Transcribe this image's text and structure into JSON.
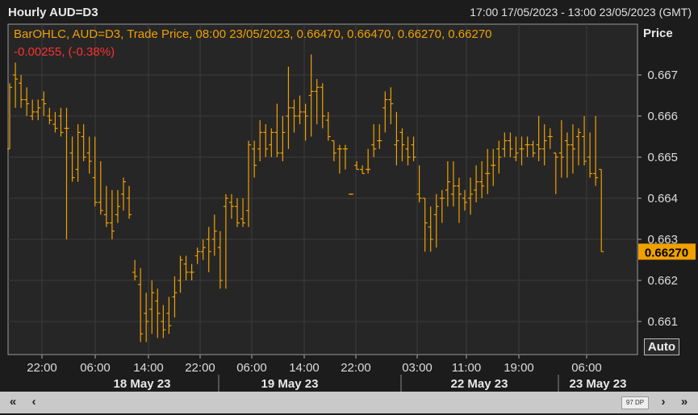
{
  "window": {
    "title": "Hourly AUD=D3",
    "date_range": "17:00 17/05/2023 - 13:00 23/05/2023 (GMT)"
  },
  "legend": {
    "line1": "BarOHLC, AUD=D3, Trade Price, 08:00 23/05/2023, 0.66470, 0.66470, 0.66270, 0.66270",
    "line2": "-0.00255, (-0.38%)",
    "color_series": "#f0a000",
    "color_change": "#ff3030"
  },
  "price_axis": {
    "label": "Price",
    "last_value": "0.66270",
    "auto_label": "Auto"
  },
  "nav": {
    "back_all": "«",
    "back": "‹",
    "points": "97 DP",
    "forward": "›",
    "forward_all": "»"
  },
  "chart_data": {
    "type": "ohlc",
    "title": "Hourly AUD=D3",
    "ylabel": "Price",
    "ylim": [
      0.6604,
      0.6675
    ],
    "yticks": [
      "0.667",
      "0.666",
      "0.665",
      "0.664",
      "0.663",
      "0.662",
      "0.661"
    ],
    "x_time_labels": [
      "22:00",
      "06:00",
      "14:00",
      "22:00",
      "06:00",
      "14:00",
      "22:00",
      "03:00",
      "11:00",
      "19:00",
      "06:00"
    ],
    "x_date_labels": [
      "18 May 23",
      "19 May 23",
      "22 May 23",
      "23 May 23"
    ],
    "grid": true,
    "series": [
      {
        "name": "AUD=D3",
        "color": "#f0a000",
        "bars": [
          [
            0.6652,
            0.6668,
            0.6652,
            0.6667
          ],
          [
            0.667,
            0.6673,
            0.6662,
            0.6669
          ],
          [
            0.6668,
            0.667,
            0.6662,
            0.6664
          ],
          [
            0.6664,
            0.6667,
            0.666,
            0.6663
          ],
          [
            0.666,
            0.6664,
            0.6659,
            0.6661
          ],
          [
            0.6661,
            0.6664,
            0.6659,
            0.6662
          ],
          [
            0.6664,
            0.6666,
            0.666,
            0.6663
          ],
          [
            0.666,
            0.6662,
            0.6658,
            0.6659
          ],
          [
            0.6658,
            0.6661,
            0.6656,
            0.6657
          ],
          [
            0.666,
            0.6662,
            0.6655,
            0.6656
          ],
          [
            0.6657,
            0.6662,
            0.663,
            0.6657
          ],
          [
            0.6651,
            0.6655,
            0.6644,
            0.6645
          ],
          [
            0.6647,
            0.6658,
            0.6644,
            0.6656
          ],
          [
            0.6655,
            0.6658,
            0.6649,
            0.665
          ],
          [
            0.6651,
            0.6655,
            0.6646,
            0.6649
          ],
          [
            0.6645,
            0.6655,
            0.6638,
            0.6639
          ],
          [
            0.6639,
            0.6649,
            0.6636,
            0.6637
          ],
          [
            0.6636,
            0.6643,
            0.6633,
            0.6634
          ],
          [
            0.6634,
            0.6642,
            0.663,
            0.6632
          ],
          [
            0.6636,
            0.6642,
            0.6634,
            0.6638
          ],
          [
            0.6641,
            0.6645,
            0.6637,
            0.6644
          ],
          [
            0.664,
            0.6643,
            0.6635,
            0.6636
          ],
          [
            0.6622,
            0.6625,
            0.662,
            0.6621
          ],
          [
            0.6619,
            0.6623,
            0.6605,
            0.6607
          ],
          [
            0.6612,
            0.6617,
            0.6605,
            0.661
          ],
          [
            0.6613,
            0.662,
            0.6607,
            0.6617
          ],
          [
            0.6615,
            0.6618,
            0.6606,
            0.6612
          ],
          [
            0.661,
            0.6614,
            0.6606,
            0.6608
          ],
          [
            0.6612,
            0.6616,
            0.6607,
            0.6609
          ],
          [
            0.6616,
            0.6621,
            0.6611,
            0.6617
          ],
          [
            0.662,
            0.6626,
            0.6617,
            0.6625
          ],
          [
            0.6624,
            0.6626,
            0.662,
            0.6622
          ],
          [
            0.6622,
            0.6624,
            0.662,
            0.6622
          ],
          [
            0.6626,
            0.6628,
            0.6624,
            0.6627
          ],
          [
            0.6627,
            0.663,
            0.6625,
            0.6628
          ],
          [
            0.663,
            0.6633,
            0.6622,
            0.6627
          ],
          [
            0.663,
            0.6636,
            0.6626,
            0.6632
          ],
          [
            0.6628,
            0.6632,
            0.6618,
            0.662
          ],
          [
            0.6638,
            0.6641,
            0.6618,
            0.664
          ],
          [
            0.6639,
            0.6641,
            0.6635,
            0.6638
          ],
          [
            0.6638,
            0.664,
            0.6633,
            0.6634
          ],
          [
            0.6635,
            0.664,
            0.6633,
            0.6634
          ],
          [
            0.6637,
            0.6654,
            0.6633,
            0.6653
          ],
          [
            0.6652,
            0.6654,
            0.6645,
            0.6648
          ],
          [
            0.6652,
            0.6659,
            0.6649,
            0.6656
          ],
          [
            0.6656,
            0.6658,
            0.665,
            0.6652
          ],
          [
            0.6653,
            0.6657,
            0.665,
            0.6656
          ],
          [
            0.6656,
            0.6663,
            0.665,
            0.6651
          ],
          [
            0.6651,
            0.666,
            0.6649,
            0.6656
          ],
          [
            0.666,
            0.6672,
            0.6652,
            0.6662
          ],
          [
            0.6662,
            0.6664,
            0.6656,
            0.666
          ],
          [
            0.666,
            0.6665,
            0.6658,
            0.6661
          ],
          [
            0.6661,
            0.6663,
            0.6654,
            0.666
          ],
          [
            0.6665,
            0.6675,
            0.6655,
            0.6666
          ],
          [
            0.6666,
            0.6669,
            0.6658,
            0.6667
          ],
          [
            0.6667,
            0.6668,
            0.6657,
            0.666
          ],
          [
            0.6659,
            0.6661,
            0.6654,
            0.6655
          ],
          [
            0.6654,
            0.6654,
            0.6649,
            0.6651
          ],
          [
            0.6652,
            0.6653,
            0.6646,
            0.6652
          ],
          [
            0.6652,
            0.6653,
            0.6647,
            0.6652
          ],
          [
            0.6641,
            0.6641,
            0.6641,
            0.6641
          ],
          [
            0.6648,
            0.6649,
            0.6647,
            0.6647
          ],
          [
            0.6647,
            0.6648,
            0.6646,
            0.6646
          ],
          [
            0.6647,
            0.6652,
            0.6646,
            0.6647
          ],
          [
            0.6653,
            0.6658,
            0.665,
            0.6652
          ],
          [
            0.6654,
            0.6658,
            0.6652,
            0.6654
          ],
          [
            0.6662,
            0.6666,
            0.6656,
            0.6664
          ],
          [
            0.6664,
            0.6667,
            0.6658,
            0.6663
          ],
          [
            0.6653,
            0.6661,
            0.6648,
            0.6654
          ],
          [
            0.6656,
            0.6657,
            0.6649,
            0.6653
          ],
          [
            0.6652,
            0.6655,
            0.6648,
            0.665
          ],
          [
            0.6653,
            0.6655,
            0.6649,
            0.665
          ],
          [
            0.6641,
            0.6648,
            0.6639,
            0.664
          ],
          [
            0.664,
            0.664,
            0.6627,
            0.6634
          ],
          [
            0.6633,
            0.6638,
            0.6627,
            0.663
          ],
          [
            0.6636,
            0.6641,
            0.6628,
            0.6638
          ],
          [
            0.664,
            0.6642,
            0.6634,
            0.664
          ],
          [
            0.6642,
            0.6649,
            0.6638,
            0.6644
          ],
          [
            0.6641,
            0.6649,
            0.6638,
            0.6643
          ],
          [
            0.6643,
            0.6645,
            0.6634,
            0.6641
          ],
          [
            0.664,
            0.6642,
            0.6637,
            0.6639
          ],
          [
            0.664,
            0.6645,
            0.6636,
            0.6641
          ],
          [
            0.6642,
            0.6648,
            0.6639,
            0.6644
          ],
          [
            0.6644,
            0.6649,
            0.664,
            0.6643
          ],
          [
            0.6646,
            0.6652,
            0.6641,
            0.6646
          ],
          [
            0.6648,
            0.6652,
            0.6643,
            0.6648
          ],
          [
            0.6652,
            0.6654,
            0.6646,
            0.665
          ],
          [
            0.6652,
            0.6656,
            0.665,
            0.6654
          ],
          [
            0.6654,
            0.6656,
            0.665,
            0.6652
          ],
          [
            0.665,
            0.6655,
            0.6649,
            0.6651
          ],
          [
            0.6652,
            0.6655,
            0.6648,
            0.6652
          ],
          [
            0.6653,
            0.6655,
            0.665,
            0.6653
          ],
          [
            0.6653,
            0.6654,
            0.665,
            0.6651
          ],
          [
            0.6653,
            0.666,
            0.6649,
            0.6652
          ],
          [
            0.6652,
            0.6658,
            0.6648,
            0.6654
          ],
          [
            0.6655,
            0.6657,
            0.6652,
            0.6655
          ],
          [
            0.6651,
            0.6651,
            0.6641,
            0.665
          ],
          [
            0.6651,
            0.6659,
            0.6645,
            0.665
          ],
          [
            0.6654,
            0.6656,
            0.6645,
            0.6653
          ],
          [
            0.6653,
            0.6658,
            0.6646,
            0.6652
          ],
          [
            0.6655,
            0.6657,
            0.6648,
            0.6656
          ],
          [
            0.6655,
            0.666,
            0.6648,
            0.6649
          ],
          [
            0.665,
            0.6656,
            0.6645,
            0.6646
          ],
          [
            0.6646,
            0.666,
            0.6643,
            0.6645
          ],
          [
            0.6647,
            0.6647,
            0.6627,
            0.6627
          ]
        ]
      }
    ]
  }
}
